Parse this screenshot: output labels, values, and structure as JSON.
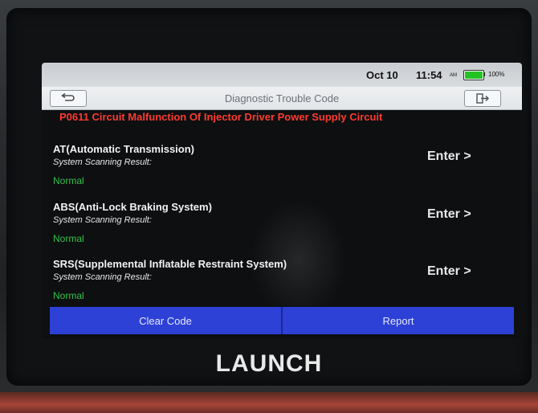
{
  "status_bar": {
    "date": "Oct 10",
    "time": "11:54",
    "ampm": "AM",
    "battery_percent_text": "100%",
    "battery_level": 1.0
  },
  "title_bar": {
    "title": "Diagnostic Trouble Code",
    "back_icon": "back-arrow-icon",
    "exit_icon": "exit-icon"
  },
  "dtc": {
    "text": "P0611 Circuit Malfunction Of Injector Driver Power Supply Circuit"
  },
  "systems": [
    {
      "name": "AT(Automatic Transmission)",
      "scan_label": "System Scanning Result:",
      "status": "Normal",
      "enter_label": "Enter >"
    },
    {
      "name": "ABS(Anti-Lock Braking System)",
      "scan_label": "System Scanning Result:",
      "status": "Normal",
      "enter_label": "Enter >"
    },
    {
      "name": "SRS(Supplemental Inflatable Restraint System)",
      "scan_label": "System Scanning Result:",
      "status": "Normal",
      "enter_label": "Enter >"
    }
  ],
  "actions": {
    "clear_code": "Clear Code",
    "report": "Report"
  },
  "brand": "LAUNCH",
  "colors": {
    "accent": "#2d41d6",
    "dtc_red": "#ff3b2f",
    "status_green": "#33c24a",
    "battery_green": "#24c322"
  }
}
